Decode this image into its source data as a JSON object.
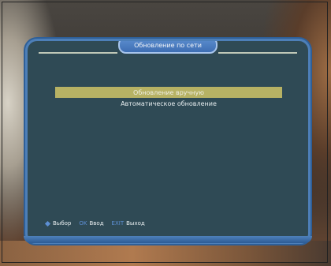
{
  "osd": {
    "title": "Обновление по сети",
    "menu_items": [
      {
        "label": "Обновление вручную",
        "selected": true
      },
      {
        "label": "Автоматическое обновление",
        "selected": false
      }
    ],
    "footer": {
      "select_label": "Выбор",
      "ok_key": "OK",
      "ok_label": "Ввод",
      "exit_key": "EXIT",
      "exit_label": "Выход"
    }
  },
  "colors": {
    "panel_bg": "#2f4a55",
    "panel_border": "#4d7fb8",
    "selected_bg": "#b7b264",
    "hint_key": "#5d8fd4"
  },
  "icons": [
    "diamond-icon"
  ]
}
